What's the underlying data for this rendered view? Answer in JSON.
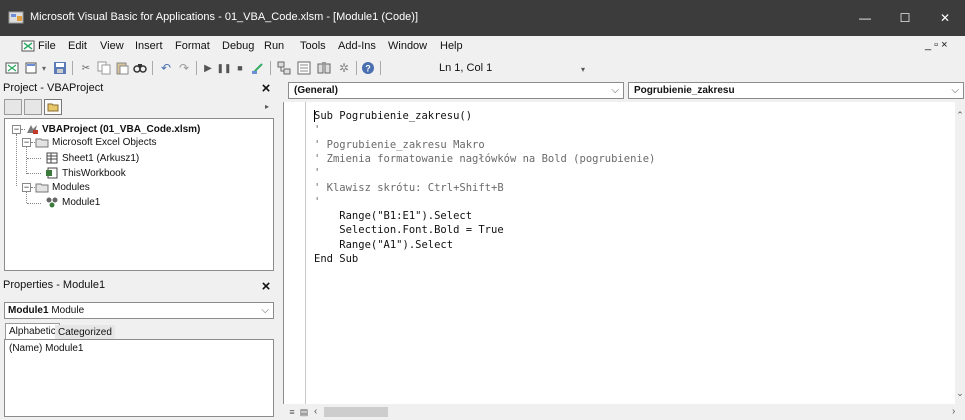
{
  "window": {
    "title": "Microsoft Visual Basic for Applications - 01_VBA_Code.xlsm - [Module1 (Code)]",
    "minimize_glyph": "—",
    "maximize_glyph": "☐",
    "close_glyph": "✕"
  },
  "menubar": {
    "items": [
      "File",
      "Edit",
      "View",
      "Insert",
      "Format",
      "Debug",
      "Run",
      "Tools",
      "Add-Ins",
      "Window",
      "Help"
    ],
    "mdi_controls": "_ ▫ ×"
  },
  "toolbar": {
    "position_label": "Ln 1, Col 1",
    "icons": [
      "excel-view-icon",
      "insert-object-icon",
      "save-icon",
      "cut-icon",
      "copy-icon",
      "paste-icon",
      "find-icon",
      "undo-icon",
      "redo-icon",
      "run-icon",
      "break-icon",
      "reset-icon",
      "design-mode-icon",
      "project-explorer-icon",
      "properties-window-icon",
      "object-browser-icon",
      "toolbox-icon",
      "help-icon"
    ]
  },
  "project_panel": {
    "title": "Project - VBAProject",
    "close_glyph": "×",
    "tree": {
      "root": "VBAProject (01_VBA_Code.xlsm)",
      "excel_objects": "Microsoft Excel Objects",
      "sheet1": "Sheet1 (Arkusz1)",
      "thisworkbook": "ThisWorkbook",
      "modules": "Modules",
      "module1": "Module1"
    }
  },
  "properties_panel": {
    "title": "Properties - Module1",
    "close_glyph": "×",
    "object_name": "Module1",
    "object_type": "Module",
    "tabs": [
      "Alphabetic",
      "Categorized"
    ],
    "rows": [
      {
        "name": "(Name)",
        "value": "Module1"
      }
    ]
  },
  "code_window": {
    "object_combo": "(General)",
    "procedure_combo": "Pogrubienie_zakresu",
    "lines": [
      {
        "text": "Sub Pogrubienie_zakresu()",
        "comment": false
      },
      {
        "text": "'",
        "comment": true
      },
      {
        "text": "' Pogrubienie_zakresu Makro",
        "comment": true
      },
      {
        "text": "' Zmienia formatowanie nagłówków na Bold (pogrubienie)",
        "comment": true
      },
      {
        "text": "'",
        "comment": true
      },
      {
        "text": "' Klawisz skrótu: Ctrl+Shift+B",
        "comment": true
      },
      {
        "text": "'",
        "comment": true
      },
      {
        "text": "    Range(\"B1:E1\").Select",
        "comment": false
      },
      {
        "text": "    Selection.Font.Bold = True",
        "comment": false
      },
      {
        "text": "    Range(\"A1\").Select",
        "comment": false
      },
      {
        "text": "End Sub",
        "comment": false
      }
    ]
  }
}
